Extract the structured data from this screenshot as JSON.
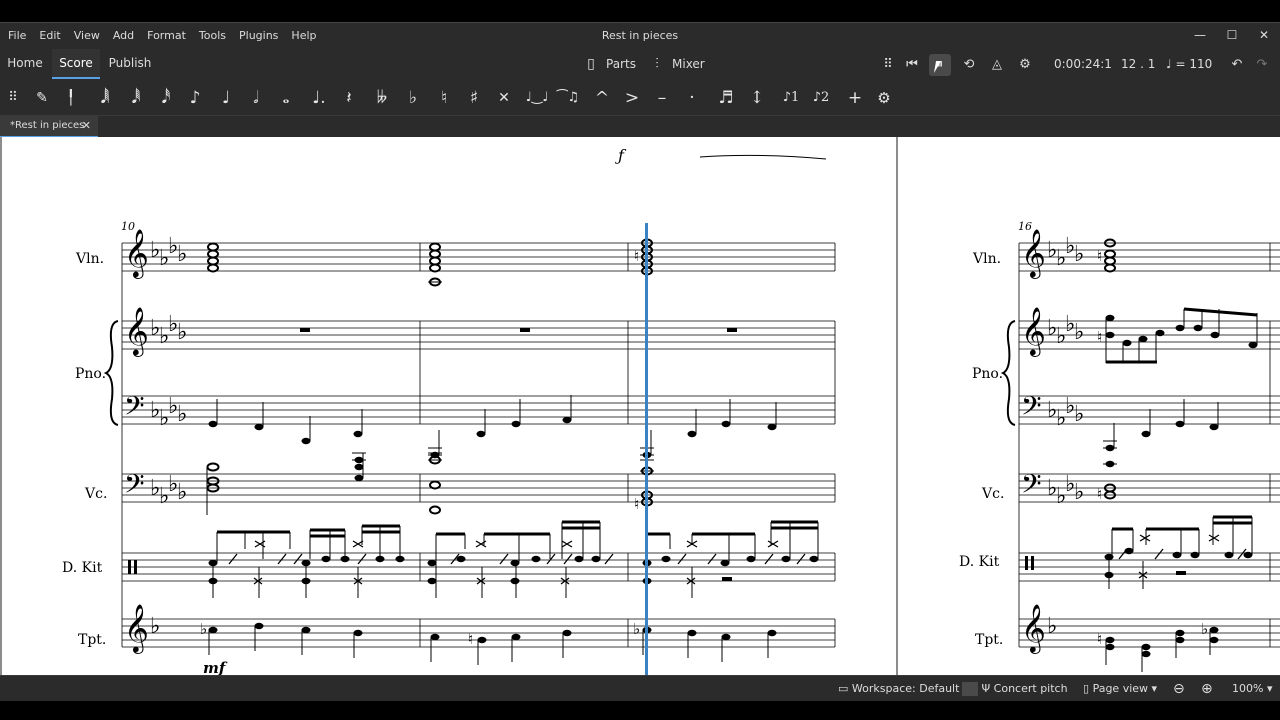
{
  "menu": [
    "File",
    "Edit",
    "View",
    "Add",
    "Format",
    "Tools",
    "Plugins",
    "Help"
  ],
  "window_title": "Rest in pieces",
  "window_controls": {
    "minimize": "—",
    "maximize": "☐",
    "close": "✕"
  },
  "tabs": {
    "home": "Home",
    "score": "Score",
    "publish": "Publish"
  },
  "parts_label": "Parts",
  "mixer_label": "Mixer",
  "playback": {
    "time": "0:00:24:1",
    "position": "12 . 1",
    "tempo": "= 110"
  },
  "doc_tab": "*Rest in pieces",
  "doc_tab_close": "✕",
  "score": {
    "measure_numbers": [
      "10",
      "16"
    ],
    "instruments_left": [
      "Vln.",
      "Pno.",
      "Vc.",
      "D. Kit",
      "Tpt."
    ],
    "instruments_right": [
      "Vln.",
      "Pno.",
      "Vc.",
      "D. Kit",
      "Tpt."
    ],
    "dynamic": "mf"
  },
  "status": {
    "workspace": "Workspace: Default",
    "concert_pitch": "Concert pitch",
    "page_view": "Page view",
    "zoom": "100%"
  },
  "colors": {
    "accent": "#5aa0e6",
    "cursor": "#3b82c4",
    "canvas": "#8c8c8c",
    "chrome": "#2b2b2b"
  }
}
